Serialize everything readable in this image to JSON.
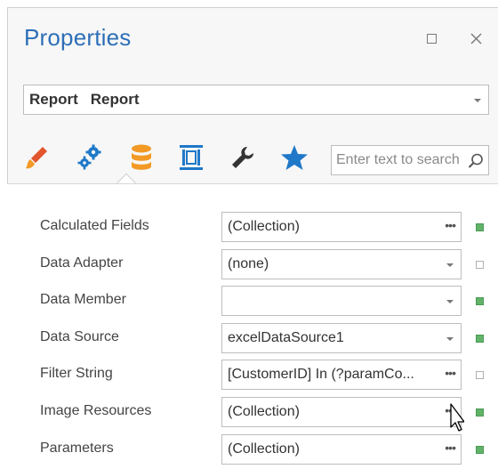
{
  "panel": {
    "title": "Properties"
  },
  "object_selector": {
    "type": "Report",
    "name": "Report"
  },
  "toolbar": {
    "tabs": [
      {
        "icon": "brush-icon",
        "color": "#e2552d"
      },
      {
        "icon": "gears-icon",
        "color": "#1f78c8"
      },
      {
        "icon": "database-icon",
        "color": "#f29a25",
        "selected": true
      },
      {
        "icon": "report-band-icon",
        "color": "#1f78c8"
      },
      {
        "icon": "wrench-icon",
        "color": "#333333"
      },
      {
        "icon": "star-icon",
        "color": "#1f78c8"
      }
    ]
  },
  "search": {
    "placeholder": "Enter text to search"
  },
  "properties": [
    {
      "label": "Calculated Fields",
      "value": "(Collection)",
      "editor": "ellipsis",
      "modified": true
    },
    {
      "label": "Data Adapter",
      "value": "(none)",
      "editor": "dropdown",
      "modified": false
    },
    {
      "label": "Data Member",
      "value": "",
      "editor": "dropdown",
      "modified": true
    },
    {
      "label": "Data Source",
      "value": "excelDataSource1",
      "editor": "dropdown",
      "modified": true
    },
    {
      "label": "Filter String",
      "value": "[CustomerID] In (?paramCo...",
      "editor": "ellipsis",
      "modified": false
    },
    {
      "label": "Image Resources",
      "value": "(Collection)",
      "editor": "ellipsis",
      "modified": true
    },
    {
      "label": "Parameters",
      "value": "(Collection)",
      "editor": "ellipsis",
      "modified": true
    }
  ],
  "colors": {
    "title": "#2d6fb7",
    "modified_marker": "#62b36a"
  }
}
